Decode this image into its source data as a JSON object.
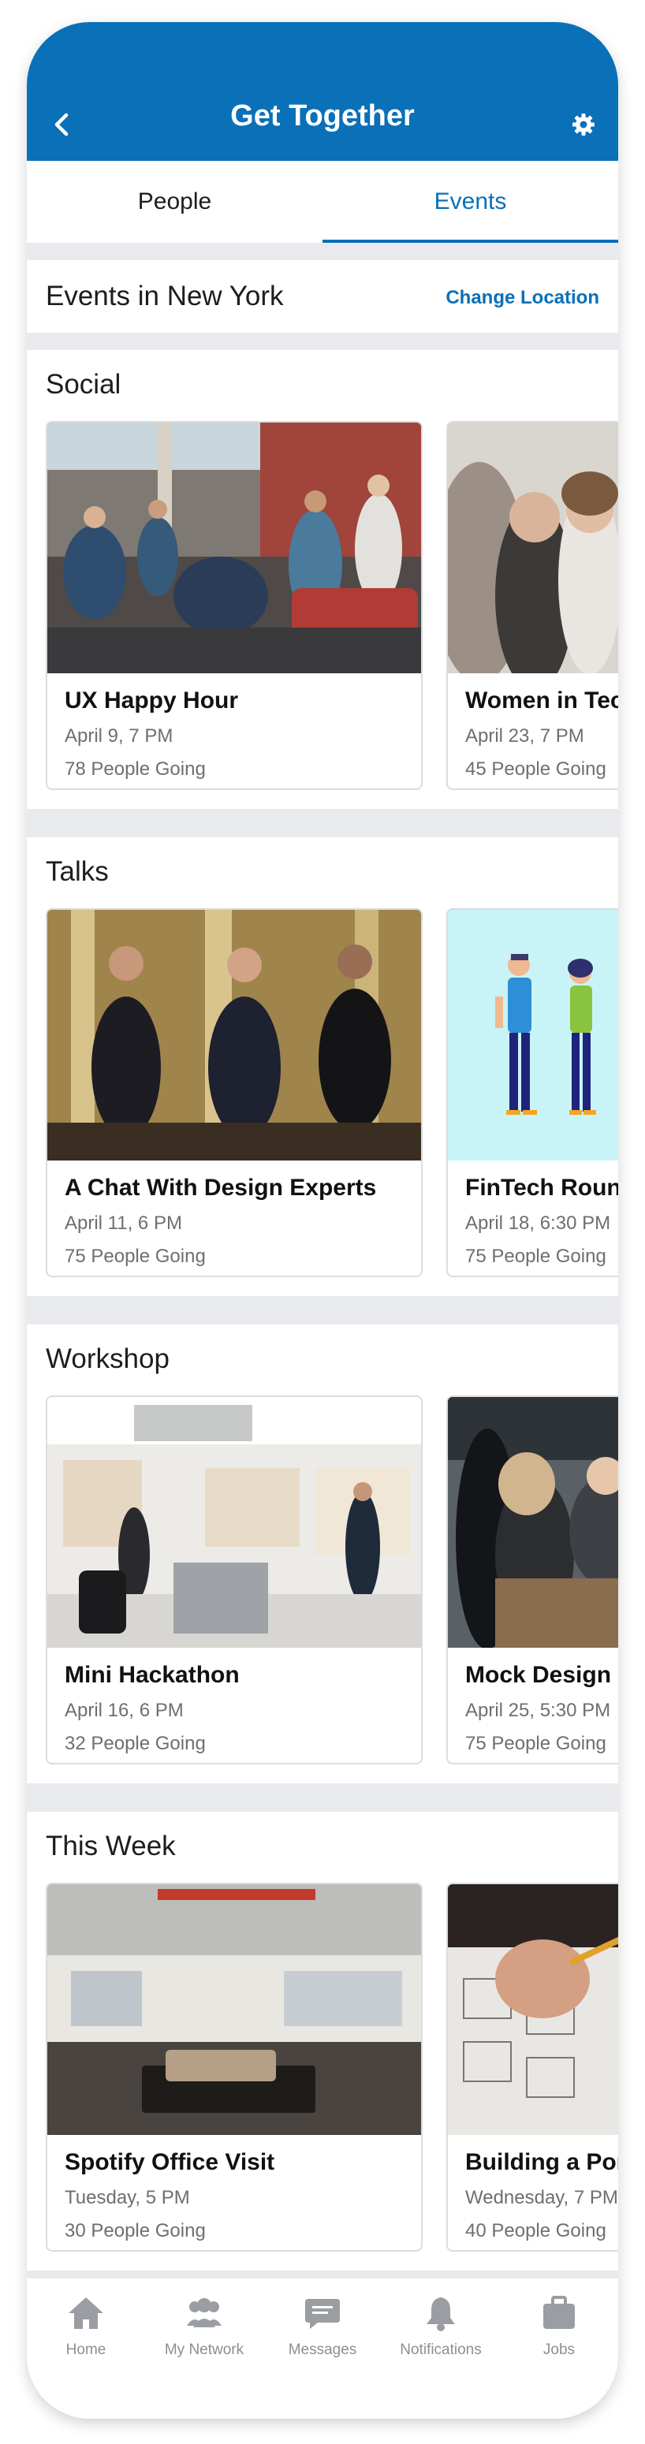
{
  "header": {
    "title": "Get Together",
    "back_icon": "chevron-left-icon",
    "settings_icon": "gear-icon"
  },
  "tabs": [
    {
      "label": "People",
      "active": false
    },
    {
      "label": "Events",
      "active": true
    }
  ],
  "location": {
    "title": "Events in New York",
    "change_label": "Change Location"
  },
  "sections": [
    {
      "title": "Social",
      "cards": [
        {
          "name": "UX Happy Hour",
          "date": "April 9, 7 PM",
          "going": "78 People Going"
        },
        {
          "name": "Women in Tec",
          "date": "April 23, 7 PM",
          "going": "45 People Going"
        }
      ]
    },
    {
      "title": "Talks",
      "cards": [
        {
          "name": "A Chat With Design Experts",
          "date": "April 11, 6 PM",
          "going": "75 People Going"
        },
        {
          "name": "FinTech Round",
          "date": "April 18, 6:30 PM",
          "going": "75 People Going"
        }
      ]
    },
    {
      "title": "Workshop",
      "cards": [
        {
          "name": "Mini Hackathon",
          "date": "April 16, 6 PM",
          "going": "32 People Going"
        },
        {
          "name": "Mock Design I",
          "date": "April 25, 5:30 PM",
          "going": "75 People Going"
        }
      ]
    },
    {
      "title": "This Week",
      "cards": [
        {
          "name": "Spotify Office Visit",
          "date": "Tuesday, 5 PM",
          "going": "30 People Going"
        },
        {
          "name": "Building a Por",
          "date": "Wednesday, 7 PM",
          "going": "40 People Going"
        }
      ]
    }
  ],
  "nav": [
    {
      "label": "Home",
      "icon": "home-icon"
    },
    {
      "label": "My Network",
      "icon": "network-icon"
    },
    {
      "label": "Messages",
      "icon": "messages-icon"
    },
    {
      "label": "Notifications",
      "icon": "bell-icon"
    },
    {
      "label": "Jobs",
      "icon": "briefcase-icon"
    }
  ],
  "colors": {
    "primary": "#0a70b8",
    "background": "#e8eaed",
    "nav_icon": "#9a9ea3"
  }
}
